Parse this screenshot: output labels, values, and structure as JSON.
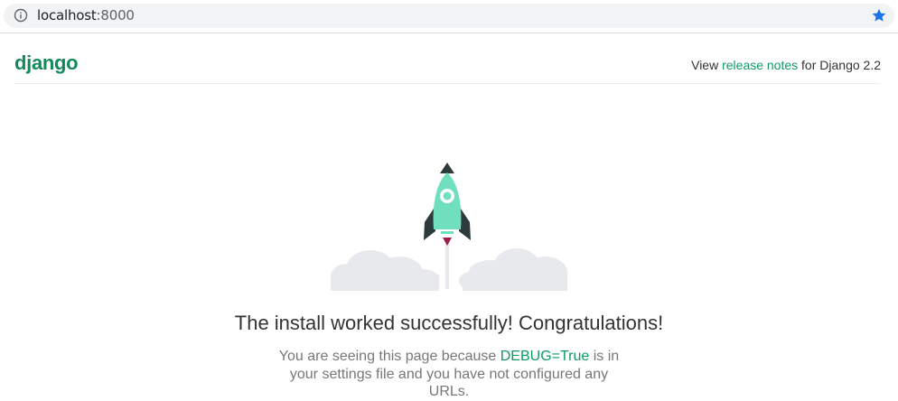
{
  "browser": {
    "url_host": "localhost",
    "url_port": ":8000"
  },
  "header": {
    "logo": "django",
    "release_prefix": "View",
    "release_link": "release notes",
    "release_suffix": "for Django 2.2"
  },
  "main": {
    "title": "The install worked successfully! Congratulations!",
    "desc_prefix": "You are seeing this page because",
    "desc_debug": "DEBUG=True",
    "desc_suffix": "is in your settings file and you have not configured any URLs."
  },
  "colors": {
    "brand": "#148a5a",
    "link": "#0c9b63",
    "rocket_body": "#6fdfbe",
    "rocket_dark": "#2e3b3a",
    "flame": "#a01b4b",
    "cloud": "#e8e9ec",
    "star": "#1a73e8"
  },
  "icons": {
    "info": "info-icon",
    "star": "star-icon",
    "rocket": "rocket-icon"
  }
}
